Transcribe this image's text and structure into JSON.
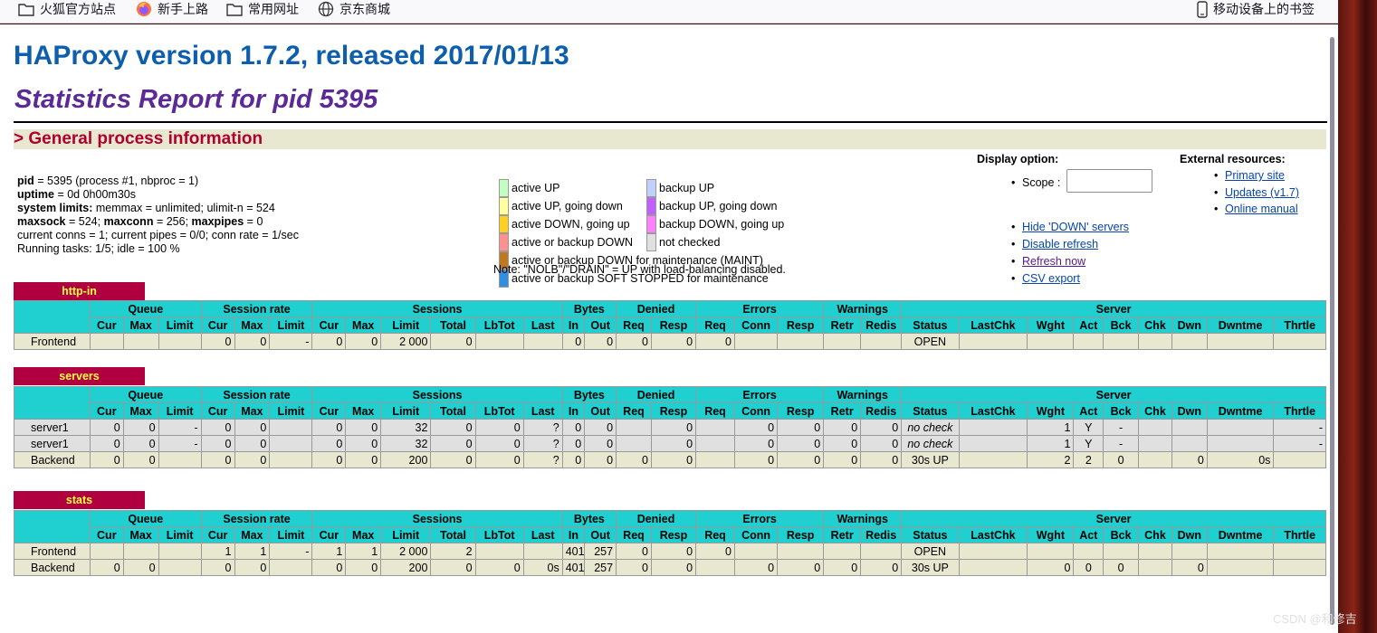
{
  "bookmarks": [
    {
      "label": "火狐官方站点",
      "icon": "folder-icon"
    },
    {
      "label": "新手上路",
      "icon": "firefox-icon"
    },
    {
      "label": "常用网址",
      "icon": "folder-icon"
    },
    {
      "label": "京东商城",
      "icon": "globe-icon"
    },
    {
      "label": "移动设备上的书签",
      "icon": "mobile-icon"
    }
  ],
  "page": {
    "title": "HAProxy version 1.7.2, released 2017/01/13",
    "subtitle": "Statistics Report for pid 5395",
    "section": "> General process information"
  },
  "process": {
    "pid_label": "pid",
    "pid_value": " = 5395 (process #1, nbproc = 1)",
    "uptime_label": "uptime",
    "uptime_value": " = 0d 0h00m30s",
    "limits_label": "system limits:",
    "limits_value": " memmax = unlimited; ulimit-n = 524",
    "maxsock_label": "maxsock",
    "maxsock_value": " = 524; ",
    "maxconn_label": "maxconn",
    "maxconn_value": " = 256; ",
    "maxpipes_label": "maxpipes",
    "maxpipes_value": " = 0",
    "conns": "current conns = 1; current pipes = 0/0; conn rate = 1/sec",
    "tasks": "Running tasks: 1/5; idle = 100 %"
  },
  "legend": {
    "items": [
      {
        "label": "active UP",
        "color": "#c0ffc0"
      },
      {
        "label": "active UP, going down",
        "color": "#ffffa0"
      },
      {
        "label": "active DOWN, going up",
        "color": "#ffd020"
      },
      {
        "label": "active or backup DOWN",
        "color": "#ff9090"
      },
      {
        "label": "active or backup DOWN for maintenance (MAINT)",
        "color": "#c07820"
      },
      {
        "label": "active or backup SOFT STOPPED for maintenance",
        "color": "#3090e0"
      },
      {
        "label": "backup UP",
        "color": "#c0d0ff"
      },
      {
        "label": "backup UP, going down",
        "color": "#c060ff"
      },
      {
        "label": "backup DOWN, going up",
        "color": "#ff80ff"
      },
      {
        "label": "not checked",
        "color": "#e0e0e0"
      }
    ],
    "note": "Note: \"NOLB\"/\"DRAIN\" = UP with load-balancing disabled."
  },
  "display": {
    "heading": "Display option:",
    "scope_label": "Scope :",
    "scope_value": "",
    "links": [
      "Hide 'DOWN' servers",
      "Disable refresh",
      "Refresh now",
      "CSV export"
    ]
  },
  "external": {
    "heading": "External resources:",
    "links": [
      "Primary site",
      "Updates (v1.7)",
      "Online manual"
    ]
  },
  "groups": [
    "Queue",
    "Session rate",
    "Sessions",
    "Bytes",
    "Denied",
    "Errors",
    "Warnings",
    "Server"
  ],
  "columns": [
    "Cur",
    "Max",
    "Limit",
    "Cur",
    "Max",
    "Limit",
    "Cur",
    "Max",
    "Limit",
    "Total",
    "LbTot",
    "Last",
    "In",
    "Out",
    "Req",
    "Resp",
    "Req",
    "Conn",
    "Resp",
    "Retr",
    "Redis",
    "Status",
    "LastChk",
    "Wght",
    "Act",
    "Bck",
    "Chk",
    "Dwn",
    "Dwntme",
    "Thrtle"
  ],
  "proxies": [
    {
      "name": "http-in",
      "rows": [
        {
          "kind": "fe",
          "cells": [
            "Frontend",
            "",
            "",
            "",
            "0",
            "0",
            "-",
            "0",
            "0",
            "2 000",
            "0",
            "",
            "",
            "0",
            "0",
            "0",
            "0",
            "0",
            "",
            "",
            "",
            "",
            "OPEN",
            "",
            "",
            "",
            "",
            "",
            "",
            "",
            ""
          ]
        }
      ]
    },
    {
      "name": "servers",
      "rows": [
        {
          "kind": "sv",
          "cells": [
            "server1",
            "0",
            "0",
            "-",
            "0",
            "0",
            "",
            "0",
            "0",
            "32",
            "0",
            "0",
            "?",
            "0",
            "0",
            "",
            "0",
            "",
            "0",
            "0",
            "0",
            "0",
            "no check",
            "",
            "1",
            "Y",
            "-",
            "",
            "",
            "",
            "-"
          ]
        },
        {
          "kind": "sv",
          "cells": [
            "server1",
            "0",
            "0",
            "-",
            "0",
            "0",
            "",
            "0",
            "0",
            "32",
            "0",
            "0",
            "?",
            "0",
            "0",
            "",
            "0",
            "",
            "0",
            "0",
            "0",
            "0",
            "no check",
            "",
            "1",
            "Y",
            "-",
            "",
            "",
            "",
            "-"
          ]
        },
        {
          "kind": "be",
          "cells": [
            "Backend",
            "0",
            "0",
            "",
            "0",
            "0",
            "",
            "0",
            "0",
            "200",
            "0",
            "0",
            "?",
            "0",
            "0",
            "0",
            "0",
            "",
            "0",
            "0",
            "0",
            "0",
            "30s UP",
            "",
            "2",
            "2",
            "0",
            "",
            "0",
            "0s",
            ""
          ]
        }
      ]
    },
    {
      "name": "stats",
      "rows": [
        {
          "kind": "fe",
          "cells": [
            "Frontend",
            "",
            "",
            "",
            "1",
            "1",
            "-",
            "1",
            "1",
            "2 000",
            "2",
            "",
            "",
            "401",
            "257",
            "0",
            "0",
            "0",
            "",
            "",
            "",
            "",
            "OPEN",
            "",
            "",
            "",
            "",
            "",
            "",
            "",
            ""
          ]
        },
        {
          "kind": "be",
          "cells": [
            "Backend",
            "0",
            "0",
            "",
            "0",
            "0",
            "",
            "0",
            "0",
            "200",
            "0",
            "0",
            "0s",
            "401",
            "257",
            "0",
            "0",
            "",
            "0",
            "0",
            "0",
            "0",
            "30s UP",
            "",
            "0",
            "0",
            "0",
            "",
            "0",
            "",
            ""
          ]
        }
      ]
    }
  ],
  "watermark": "CSDN @和修吉"
}
